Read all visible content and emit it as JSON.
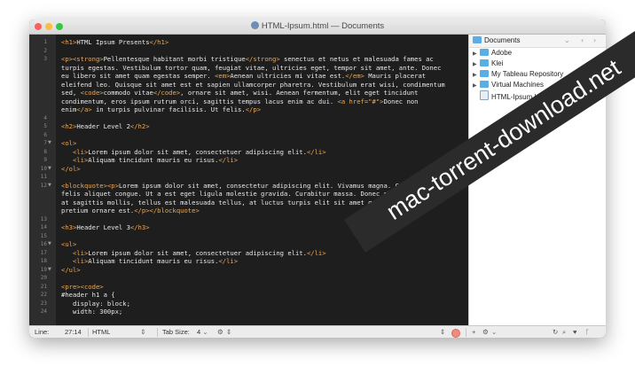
{
  "window": {
    "title": "HTML-Ipsum.html — Documents"
  },
  "editor": {
    "lines": [
      {
        "n": "1",
        "text": "<h1>HTML Ipsum Presents</h1>"
      },
      {
        "n": "2",
        "text": ""
      },
      {
        "n": "3",
        "text": "<p><strong>Pellentesque habitant morbi tristique</strong> senectus et netus et malesuada fames ac"
      },
      {
        "n": "",
        "text": "turpis egestas. Vestibulum tortor quam, feugiat vitae, ultricies eget, tempor sit amet, ante. Donec"
      },
      {
        "n": "",
        "text": "eu libero sit amet quam egestas semper. <em>Aenean ultricies mi vitae est.</em> Mauris placerat"
      },
      {
        "n": "",
        "text": "eleifend leo. Quisque sit amet est et sapien ullamcorper pharetra. Vestibulum erat wisi, condimentum"
      },
      {
        "n": "",
        "text": "sed, <code>commodo vitae</code>, ornare sit amet, wisi. Aenean fermentum, elit eget tincidunt"
      },
      {
        "n": "",
        "text": "condimentum, eros ipsum rutrum orci, sagittis tempus lacus enim ac dui. <a href=\"#\">Donec non"
      },
      {
        "n": "",
        "text": "enim</a> in turpis pulvinar facilisis. Ut felis.</p>"
      },
      {
        "n": "4",
        "text": ""
      },
      {
        "n": "5",
        "text": "<h2>Header Level 2</h2>"
      },
      {
        "n": "6",
        "text": ""
      },
      {
        "n": "7",
        "text": "<ol>",
        "fold": true
      },
      {
        "n": "8",
        "text": "   <li>Lorem ipsum dolor sit amet, consectetuer adipiscing elit.</li>"
      },
      {
        "n": "9",
        "text": "   <li>Aliquam tincidunt mauris eu risus.</li>"
      },
      {
        "n": "10",
        "text": "</ol>",
        "fold": true
      },
      {
        "n": "11",
        "text": ""
      },
      {
        "n": "12",
        "text": "<blockquote><p>Lorem ipsum dolor sit amet, consectetur adipiscing elit. Vivamus magna. Cras in mi at",
        "fold": true
      },
      {
        "n": "",
        "text": "felis aliquet congue. Ut a est eget ligula molestie gravida. Curabitur massa. Donec eleifend, libero"
      },
      {
        "n": "",
        "text": "at sagittis mollis, tellus est malesuada tellus, at luctus turpis elit sit amet quam. Vivamus"
      },
      {
        "n": "",
        "text": "pretium ornare est.</p></blockquote>"
      },
      {
        "n": "13",
        "text": ""
      },
      {
        "n": "14",
        "text": "<h3>Header Level 3</h3>"
      },
      {
        "n": "15",
        "text": ""
      },
      {
        "n": "16",
        "text": "<ul>",
        "fold": true
      },
      {
        "n": "17",
        "text": "   <li>Lorem ipsum dolor sit amet, consectetuer adipiscing elit.</li>"
      },
      {
        "n": "18",
        "text": "   <li>Aliquam tincidunt mauris eu risus.</li>"
      },
      {
        "n": "19",
        "text": "</ul>",
        "fold": true
      },
      {
        "n": "20",
        "text": ""
      },
      {
        "n": "21",
        "text": "<pre><code>"
      },
      {
        "n": "22",
        "text": "#header h1 a {"
      },
      {
        "n": "23",
        "text": "   display: block;"
      },
      {
        "n": "24",
        "text": "   width: 300px;"
      }
    ]
  },
  "sidebar": {
    "title": "Documents",
    "nav_back": "‹",
    "nav_forward": "›",
    "menu_chevron": "⌄",
    "items": [
      {
        "label": "Adobe",
        "type": "folder"
      },
      {
        "label": "Klei",
        "type": "folder"
      },
      {
        "label": "My Tableau Repository",
        "type": "folder"
      },
      {
        "label": "Virtual Machines",
        "type": "folder"
      },
      {
        "label": "HTML-Ipsum.html",
        "type": "file"
      }
    ],
    "close_symbol": "×"
  },
  "statusbar": {
    "line_label": "Line:",
    "position": "27:14",
    "syntax": "HTML",
    "tab_size_label": "Tab Size:",
    "tab_size_value": "4"
  },
  "watermark": "mac-torrent-download.net"
}
